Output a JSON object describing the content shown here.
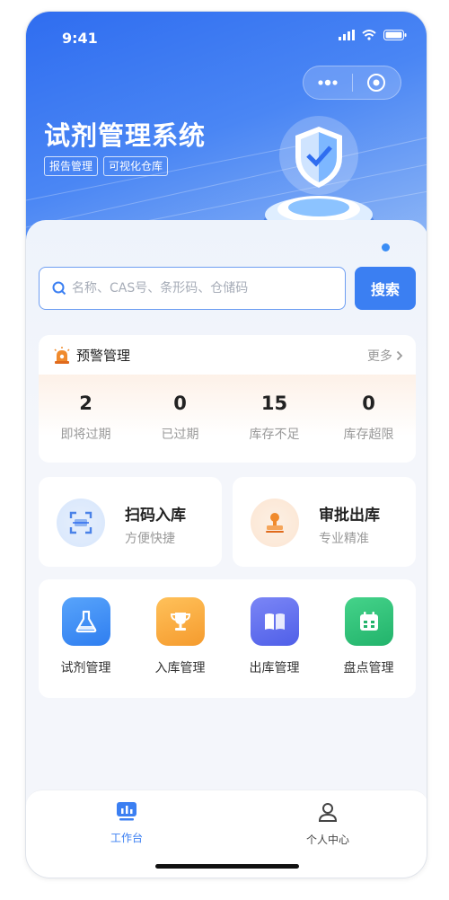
{
  "status_bar": {
    "time": "9:41"
  },
  "header": {
    "title": "试剂管理系统",
    "tags": [
      "报告管理",
      "可视化仓库"
    ]
  },
  "search": {
    "placeholder": "名称、CAS号、条形码、仓储码",
    "button_label": "搜索"
  },
  "warning": {
    "title": "预警管理",
    "more_label": "更多",
    "stats": [
      {
        "value": "2",
        "label": "即将过期"
      },
      {
        "value": "0",
        "label": "已过期"
      },
      {
        "value": "15",
        "label": "库存不足"
      },
      {
        "value": "0",
        "label": "库存超限"
      }
    ]
  },
  "quick_actions": [
    {
      "title": "扫码入库",
      "subtitle": "方便快捷",
      "icon": "scan-icon"
    },
    {
      "title": "审批出库",
      "subtitle": "专业精准",
      "icon": "stamp-icon"
    }
  ],
  "modules": [
    {
      "label": "试剂管理",
      "icon": "flask-icon",
      "color": "#3b8af0"
    },
    {
      "label": "入库管理",
      "icon": "trophy-icon",
      "color": "#f5a43a"
    },
    {
      "label": "出库管理",
      "icon": "book-icon",
      "color": "#5f6ff0"
    },
    {
      "label": "盘点管理",
      "icon": "calendar-icon",
      "color": "#2fbf77"
    }
  ],
  "tab_bar": {
    "items": [
      {
        "label": "工作台",
        "icon": "dashboard-icon",
        "active": true
      },
      {
        "label": "个人中心",
        "icon": "user-icon",
        "active": false
      }
    ]
  },
  "colors": {
    "primary": "#3b7ff2",
    "hero_start": "#2f6df0",
    "hero_end": "#9cc0f6",
    "warning_accent": "#f08a2c"
  }
}
